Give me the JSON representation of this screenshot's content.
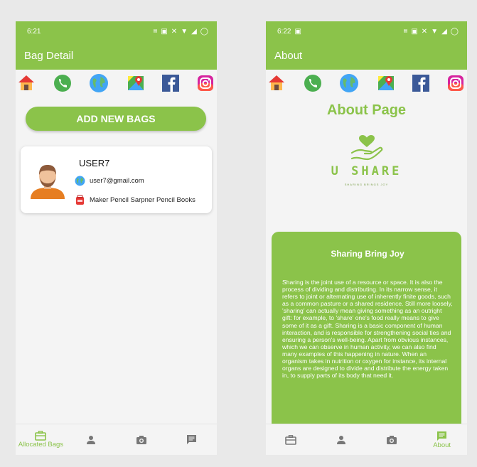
{
  "left": {
    "status": {
      "time": "6:21"
    },
    "appbar": {
      "title": "Bag Detail"
    },
    "add_button": {
      "label": "ADD NEW BAGS"
    },
    "user": {
      "name": "USER7",
      "email": "user7@gmail.com",
      "books": "Maker Pencil Sarpner Pencil Books"
    },
    "nav": [
      {
        "label": "Allocated Bags",
        "icon": "bag-icon"
      },
      {
        "label": "",
        "icon": "person-icon"
      },
      {
        "label": "",
        "icon": "camera-icon"
      },
      {
        "label": "",
        "icon": "chat-icon"
      }
    ]
  },
  "right": {
    "status": {
      "time": "6:22"
    },
    "appbar": {
      "title": "About"
    },
    "page_title": "About Page",
    "logo": {
      "text": "U SHARE",
      "tagline": "SHARING BRINGS JOY"
    },
    "card": {
      "title": "Sharing Bring Joy",
      "body": "Sharing is the joint use of a resource or space. It is also the process of dividing and distributing. In its narrow sense, it refers to joint or alternating use of inherently finite goods, such as a common pasture or a shared residence. Still more loosely, 'sharing' can actually mean giving something as an outright gift: for example, to 'share' one's food really means to give some of it as a gift. Sharing is a basic component of human interaction, and is responsible for strengthening social ties and ensuring a person's well-being.  Apart from obvious instances, which we can observe in human activity, we can also find many examples of this happening in nature. When an organism takes in nutrition or oxygen for instance, its internal organs are designed to divide and distribute the energy taken in, to supply parts of its body that need it."
    },
    "nav": [
      {
        "label": "",
        "icon": "bag-icon"
      },
      {
        "label": "",
        "icon": "person-icon"
      },
      {
        "label": "",
        "icon": "camera-icon"
      },
      {
        "label": "About",
        "icon": "chat-icon"
      }
    ]
  },
  "social_icons": [
    "home-icon",
    "phone-icon",
    "globe-icon",
    "maps-icon",
    "facebook-icon",
    "instagram-icon"
  ],
  "colors": {
    "accent": "#8bc34a",
    "background": "#f4f4f4",
    "facebook": "#3b5998"
  }
}
